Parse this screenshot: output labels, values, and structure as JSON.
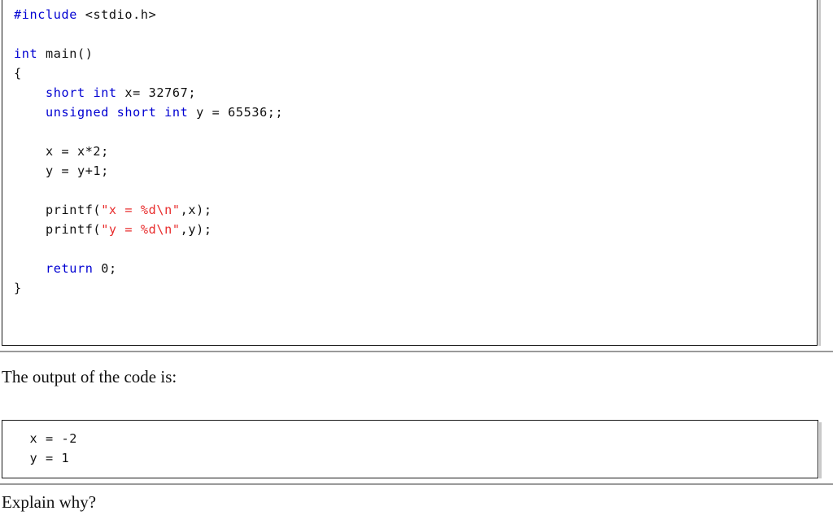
{
  "document": {
    "code_listing": {
      "language": "C",
      "lines": [
        [
          {
            "t": "#include",
            "c": "kw"
          },
          {
            "t": " <stdio.h>",
            "c": "pl"
          }
        ],
        [
          {
            "t": "",
            "c": "pl"
          }
        ],
        [
          {
            "t": "int",
            "c": "kw"
          },
          {
            "t": " main()",
            "c": "pl"
          }
        ],
        [
          {
            "t": "{",
            "c": "pl"
          }
        ],
        [
          {
            "t": "    ",
            "c": "pl"
          },
          {
            "t": "short int",
            "c": "kw"
          },
          {
            "t": " x= 32767;",
            "c": "pl"
          }
        ],
        [
          {
            "t": "    ",
            "c": "pl"
          },
          {
            "t": "unsigned short int",
            "c": "kw"
          },
          {
            "t": " y = 65536;;",
            "c": "pl"
          }
        ],
        [
          {
            "t": "",
            "c": "pl"
          }
        ],
        [
          {
            "t": "    x = x*2;",
            "c": "pl"
          }
        ],
        [
          {
            "t": "    y = y+1;",
            "c": "pl"
          }
        ],
        [
          {
            "t": "",
            "c": "pl"
          }
        ],
        [
          {
            "t": "    printf(",
            "c": "pl"
          },
          {
            "t": "\"x = %d\\n\"",
            "c": "str"
          },
          {
            "t": ",x);",
            "c": "pl"
          }
        ],
        [
          {
            "t": "    printf(",
            "c": "pl"
          },
          {
            "t": "\"y = %d\\n\"",
            "c": "str"
          },
          {
            "t": ",y);",
            "c": "pl"
          }
        ],
        [
          {
            "t": "",
            "c": "pl"
          }
        ],
        [
          {
            "t": "    ",
            "c": "pl"
          },
          {
            "t": "return",
            "c": "kw"
          },
          {
            "t": " 0;",
            "c": "pl"
          }
        ],
        [
          {
            "t": "}",
            "c": "pl"
          }
        ]
      ],
      "plain_text": "#include <stdio.h>\n\nint main()\n{\n    short int x= 32767;\n    unsigned short int y = 65536;;\n\n    x = x*2;\n    y = y+1;\n\n    printf(\"x = %d\\n\",x);\n    printf(\"y = %d\\n\",y);\n\n    return 0;\n}"
    },
    "caption_output": "The output of the code is:",
    "output_listing": {
      "lines": [
        "  x = -2",
        "  y = 1"
      ]
    },
    "question": "Explain why?",
    "colors": {
      "keyword": "#0000d2",
      "string": "#e82c2c",
      "text": "#111111",
      "box_border": "#1a1a1a",
      "rule": "#9a9a9a",
      "background": "#ffffff"
    }
  }
}
